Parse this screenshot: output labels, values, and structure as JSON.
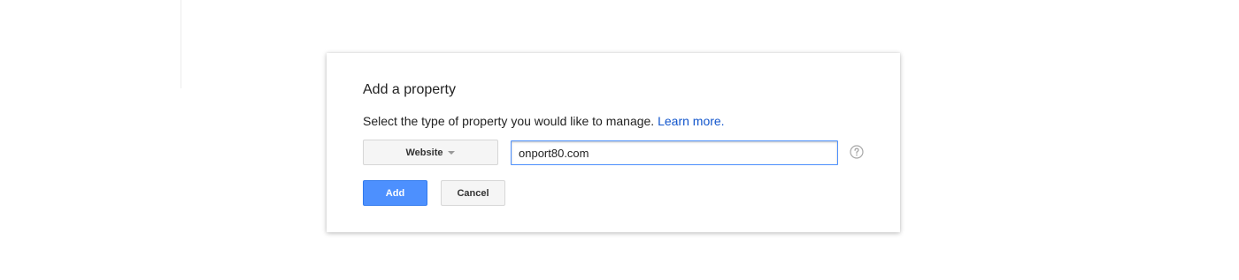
{
  "dialog": {
    "title": "Add a property",
    "instructions": "Select the type of property you would like to manage.",
    "learn_more_label": "Learn more.",
    "property_type": {
      "selected": "Website"
    },
    "url_input": {
      "value": "onport80.com"
    },
    "help_icon": "help-circle-icon",
    "buttons": {
      "add_label": "Add",
      "cancel_label": "Cancel"
    }
  },
  "colors": {
    "primary_button": "#4d90fe",
    "link": "#1155cc",
    "input_focus_border": "#4d90fe"
  }
}
